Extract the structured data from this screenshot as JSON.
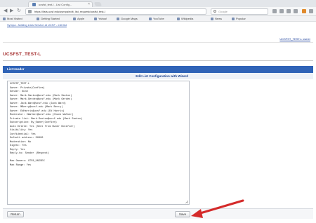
{
  "browser": {
    "tab_title": "ucsfst_test-l - List Config...",
    "url": "https://lists.ucsf.edu/sympa/edit_list_request/ucsfst_test-l",
    "search_placeholder": "Google",
    "bookmarks": [
      "Most Visited",
      "Getting Started",
      "Apple",
      "Yahoo!",
      "Google Maps",
      "YouTube",
      "Wikipedia",
      "News",
      "Popular"
    ]
  },
  "page": {
    "wp_link": "Sympa - Mailing Lists Service at UCSF - edit list",
    "user_link": "UCSFST_TEST-L owner",
    "list_title": "UCSFST_TEST-L",
    "header_label": "List Header",
    "subheader_label": "Edit List Configuration with Wizard",
    "config_lines": [
      "UCSFST_TEST-L",
      "Owner: Private(Confirm)",
      "Sender: None",
      "Owner: Mark.Saxton@ucsf.edu (Mark Saxton)",
      "Owner: Mark.Gerdes@ucsf.edu (Mark Gerdes)",
      "Owner: Jack.Ward@ucsf.edu (Jack Ward)",
      "Owner: MBerry@ucsf.edu (Mark Berry)",
      "Owner: EdHarris@ucsf.edu (Ed Harris)",
      "Moderator: CWalker@ucsf.edu (Chuck Walker)",
      "Private list: Mark.Saxton@ucsf.edu (Mark Saxton)",
      "Subscription: By_Owner(Confirm)",
      "Auto Delete: Yes (Sent from Owner Notifier)",
      "Visibility: Yes",
      "Confidential: Yes",
      "Default address: D0000",
      "Moderation: No",
      "Digest: Yes",
      "Reply: Yes",
      "Reply-to: Sender (Respect)",
      "",
      "Max Owners: UTF8_UNISEX",
      "Max Range: Yes"
    ],
    "back_button": "Return",
    "save_button": "Save"
  },
  "colors": {
    "header_blue": "#2f63b7",
    "title_red": "#a32a2a",
    "arrow_red": "#d42a2a"
  }
}
